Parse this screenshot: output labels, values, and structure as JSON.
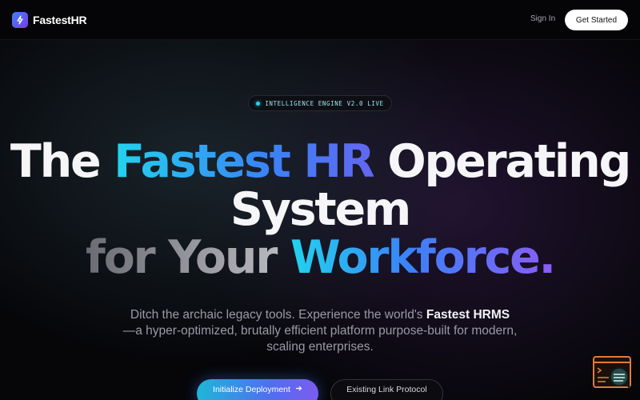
{
  "header": {
    "brand": "FastestHR",
    "sign_in": "Sign In",
    "cta": "Get Started"
  },
  "badge": {
    "text": "INTELLIGENCE ENGINE V2.0 LIVE"
  },
  "headline": {
    "line1_a": "The ",
    "line1_b": "Fastest HR",
    "line1_c": " Operating",
    "line2": "System",
    "line3_a": "for Your ",
    "line3_b": "Workforce."
  },
  "subtitle": {
    "part1": "Ditch the archaic legacy tools. Experience the world's ",
    "bold": "Fastest HRMS",
    "part2": "—a hyper-optimized, brutally efficient platform purpose-built for modern, scaling enterprises."
  },
  "actions": {
    "primary": "Initialize Deployment",
    "primary_icon": "arrow-right-icon",
    "secondary": "Existing Link Protocol"
  },
  "icons": {
    "logo": "lightning-bolt-icon",
    "widget": "terminal-search-icon"
  },
  "colors": {
    "accent_cyan": "#22d3ee",
    "accent_blue": "#3b82f6",
    "accent_violet": "#8b5cf6",
    "background": "#060609"
  }
}
